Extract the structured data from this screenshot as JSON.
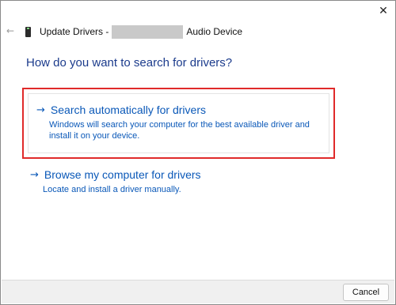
{
  "window": {
    "close_glyph": "✕",
    "back_glyph": "←"
  },
  "header": {
    "title_prefix": "Update Drivers -",
    "title_suffix": "Audio Device",
    "device_icon": "audio-device-icon"
  },
  "main": {
    "question": "How do you want to search for drivers?",
    "options": [
      {
        "arrow": "→",
        "title": "Search automatically for drivers",
        "description": "Windows will search your computer for the best available driver and install it on your device."
      },
      {
        "arrow": "→",
        "title": "Browse my computer for drivers",
        "description": "Locate and install a driver manually."
      }
    ]
  },
  "footer": {
    "cancel_label": "Cancel"
  },
  "colors": {
    "link_blue": "#0a58b8",
    "heading_blue": "#1b3b8c",
    "highlight_red": "#e02a2a"
  }
}
